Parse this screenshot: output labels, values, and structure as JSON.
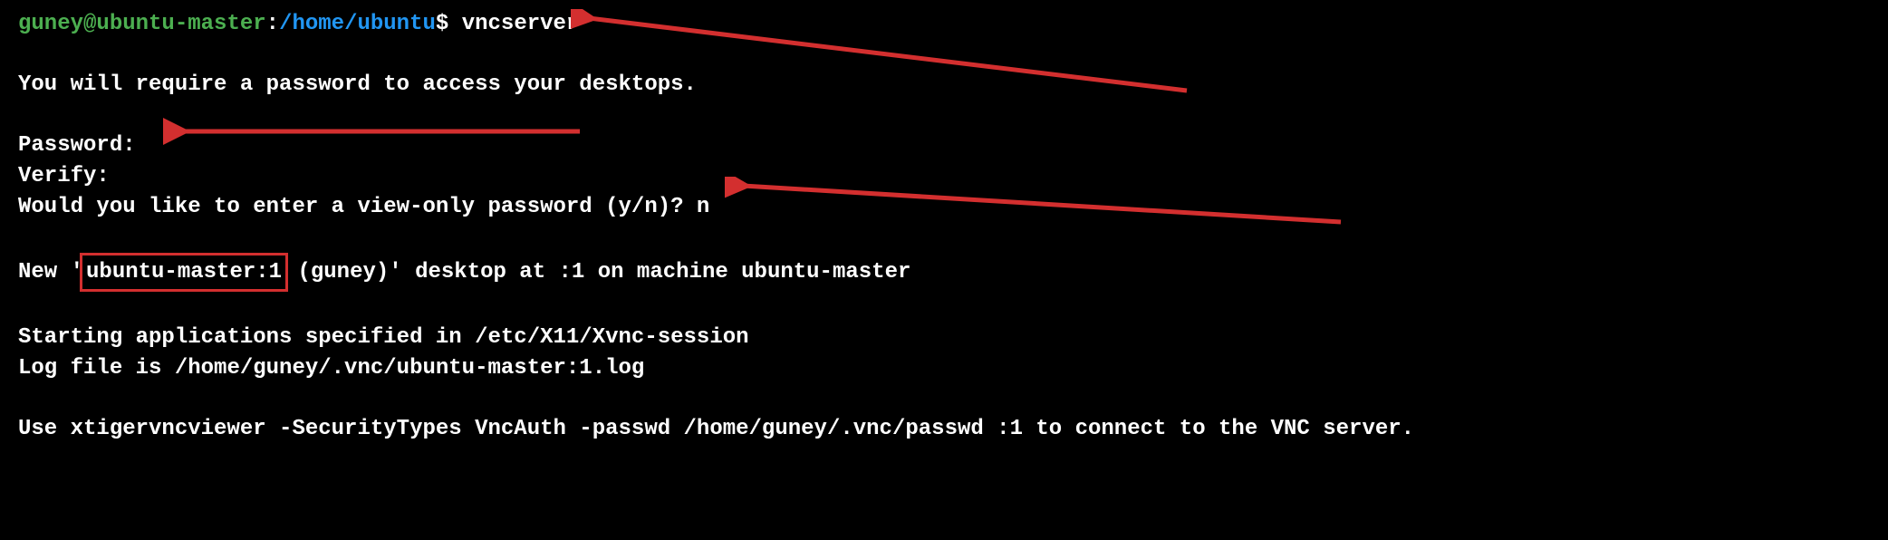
{
  "terminal": {
    "prompt": {
      "user": "guney@ubuntu-master",
      "separator": ":",
      "path": "/home/ubuntu",
      "dollar": "$ "
    },
    "command": "vncserver",
    "output": {
      "line1": "You will require a password to access your desktops.",
      "line2": "Password:",
      "line3": "Verify:",
      "line4": "Would you like to enter a view-only password (y/n)? n",
      "line5_prefix": "New '",
      "line5_highlight": "ubuntu-master:1",
      "line5_suffix": " (guney)' desktop at :1 on machine ubuntu-master",
      "line6": "Starting applications specified in /etc/X11/Xvnc-session",
      "line7": "Log file is /home/guney/.vnc/ubuntu-master:1.log",
      "line8": "Use xtigervncviewer -SecurityTypes VncAuth -passwd /home/guney/.vnc/passwd :1 to connect to the VNC server."
    }
  },
  "annotations": {
    "highlight_color": "#d32f2f",
    "arrow_color": "#d32f2f"
  }
}
